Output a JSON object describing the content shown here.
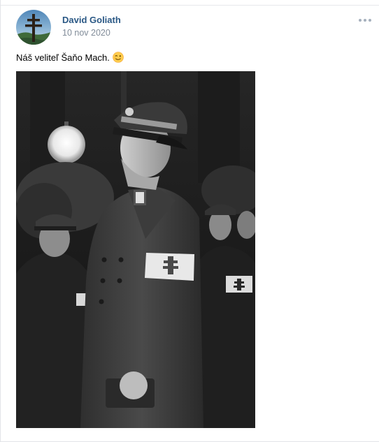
{
  "post": {
    "author": "David Goliath",
    "date": "10 nov 2020",
    "text": "Náš veliteľ Šaňo Mach.",
    "emoji_icon": "winking-face-emoji"
  },
  "colors": {
    "author_link": "#2a5885",
    "date_text": "#818c99",
    "more_dots": "#a5b0bd",
    "border": "#e3e4e8"
  }
}
